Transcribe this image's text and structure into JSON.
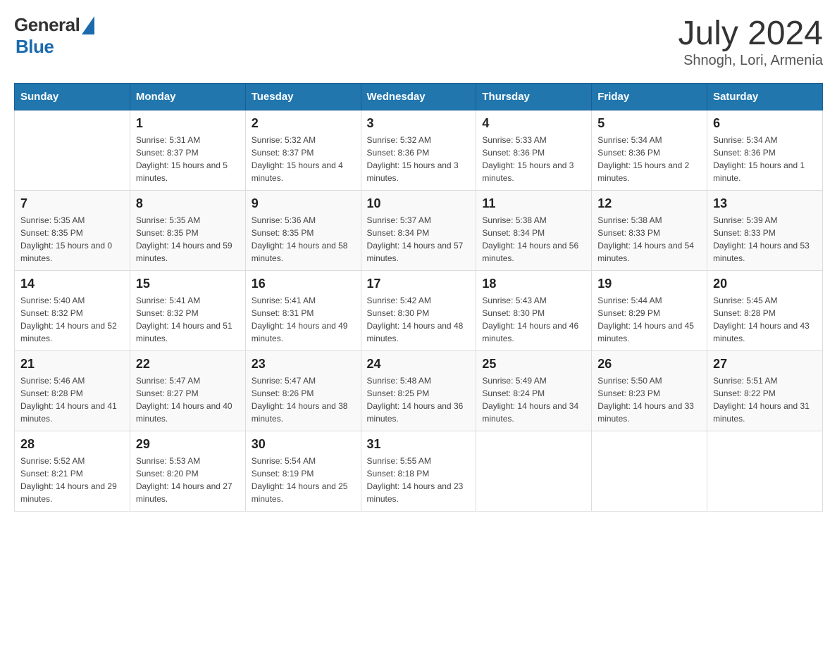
{
  "header": {
    "logo": {
      "general": "General",
      "blue": "Blue"
    },
    "month": "July 2024",
    "location": "Shnogh, Lori, Armenia"
  },
  "days_of_week": [
    "Sunday",
    "Monday",
    "Tuesday",
    "Wednesday",
    "Thursday",
    "Friday",
    "Saturday"
  ],
  "weeks": [
    [
      {
        "day": "",
        "sunrise": "",
        "sunset": "",
        "daylight": ""
      },
      {
        "day": "1",
        "sunrise": "Sunrise: 5:31 AM",
        "sunset": "Sunset: 8:37 PM",
        "daylight": "Daylight: 15 hours and 5 minutes."
      },
      {
        "day": "2",
        "sunrise": "Sunrise: 5:32 AM",
        "sunset": "Sunset: 8:37 PM",
        "daylight": "Daylight: 15 hours and 4 minutes."
      },
      {
        "day": "3",
        "sunrise": "Sunrise: 5:32 AM",
        "sunset": "Sunset: 8:36 PM",
        "daylight": "Daylight: 15 hours and 3 minutes."
      },
      {
        "day": "4",
        "sunrise": "Sunrise: 5:33 AM",
        "sunset": "Sunset: 8:36 PM",
        "daylight": "Daylight: 15 hours and 3 minutes."
      },
      {
        "day": "5",
        "sunrise": "Sunrise: 5:34 AM",
        "sunset": "Sunset: 8:36 PM",
        "daylight": "Daylight: 15 hours and 2 minutes."
      },
      {
        "day": "6",
        "sunrise": "Sunrise: 5:34 AM",
        "sunset": "Sunset: 8:36 PM",
        "daylight": "Daylight: 15 hours and 1 minute."
      }
    ],
    [
      {
        "day": "7",
        "sunrise": "Sunrise: 5:35 AM",
        "sunset": "Sunset: 8:35 PM",
        "daylight": "Daylight: 15 hours and 0 minutes."
      },
      {
        "day": "8",
        "sunrise": "Sunrise: 5:35 AM",
        "sunset": "Sunset: 8:35 PM",
        "daylight": "Daylight: 14 hours and 59 minutes."
      },
      {
        "day": "9",
        "sunrise": "Sunrise: 5:36 AM",
        "sunset": "Sunset: 8:35 PM",
        "daylight": "Daylight: 14 hours and 58 minutes."
      },
      {
        "day": "10",
        "sunrise": "Sunrise: 5:37 AM",
        "sunset": "Sunset: 8:34 PM",
        "daylight": "Daylight: 14 hours and 57 minutes."
      },
      {
        "day": "11",
        "sunrise": "Sunrise: 5:38 AM",
        "sunset": "Sunset: 8:34 PM",
        "daylight": "Daylight: 14 hours and 56 minutes."
      },
      {
        "day": "12",
        "sunrise": "Sunrise: 5:38 AM",
        "sunset": "Sunset: 8:33 PM",
        "daylight": "Daylight: 14 hours and 54 minutes."
      },
      {
        "day": "13",
        "sunrise": "Sunrise: 5:39 AM",
        "sunset": "Sunset: 8:33 PM",
        "daylight": "Daylight: 14 hours and 53 minutes."
      }
    ],
    [
      {
        "day": "14",
        "sunrise": "Sunrise: 5:40 AM",
        "sunset": "Sunset: 8:32 PM",
        "daylight": "Daylight: 14 hours and 52 minutes."
      },
      {
        "day": "15",
        "sunrise": "Sunrise: 5:41 AM",
        "sunset": "Sunset: 8:32 PM",
        "daylight": "Daylight: 14 hours and 51 minutes."
      },
      {
        "day": "16",
        "sunrise": "Sunrise: 5:41 AM",
        "sunset": "Sunset: 8:31 PM",
        "daylight": "Daylight: 14 hours and 49 minutes."
      },
      {
        "day": "17",
        "sunrise": "Sunrise: 5:42 AM",
        "sunset": "Sunset: 8:30 PM",
        "daylight": "Daylight: 14 hours and 48 minutes."
      },
      {
        "day": "18",
        "sunrise": "Sunrise: 5:43 AM",
        "sunset": "Sunset: 8:30 PM",
        "daylight": "Daylight: 14 hours and 46 minutes."
      },
      {
        "day": "19",
        "sunrise": "Sunrise: 5:44 AM",
        "sunset": "Sunset: 8:29 PM",
        "daylight": "Daylight: 14 hours and 45 minutes."
      },
      {
        "day": "20",
        "sunrise": "Sunrise: 5:45 AM",
        "sunset": "Sunset: 8:28 PM",
        "daylight": "Daylight: 14 hours and 43 minutes."
      }
    ],
    [
      {
        "day": "21",
        "sunrise": "Sunrise: 5:46 AM",
        "sunset": "Sunset: 8:28 PM",
        "daylight": "Daylight: 14 hours and 41 minutes."
      },
      {
        "day": "22",
        "sunrise": "Sunrise: 5:47 AM",
        "sunset": "Sunset: 8:27 PM",
        "daylight": "Daylight: 14 hours and 40 minutes."
      },
      {
        "day": "23",
        "sunrise": "Sunrise: 5:47 AM",
        "sunset": "Sunset: 8:26 PM",
        "daylight": "Daylight: 14 hours and 38 minutes."
      },
      {
        "day": "24",
        "sunrise": "Sunrise: 5:48 AM",
        "sunset": "Sunset: 8:25 PM",
        "daylight": "Daylight: 14 hours and 36 minutes."
      },
      {
        "day": "25",
        "sunrise": "Sunrise: 5:49 AM",
        "sunset": "Sunset: 8:24 PM",
        "daylight": "Daylight: 14 hours and 34 minutes."
      },
      {
        "day": "26",
        "sunrise": "Sunrise: 5:50 AM",
        "sunset": "Sunset: 8:23 PM",
        "daylight": "Daylight: 14 hours and 33 minutes."
      },
      {
        "day": "27",
        "sunrise": "Sunrise: 5:51 AM",
        "sunset": "Sunset: 8:22 PM",
        "daylight": "Daylight: 14 hours and 31 minutes."
      }
    ],
    [
      {
        "day": "28",
        "sunrise": "Sunrise: 5:52 AM",
        "sunset": "Sunset: 8:21 PM",
        "daylight": "Daylight: 14 hours and 29 minutes."
      },
      {
        "day": "29",
        "sunrise": "Sunrise: 5:53 AM",
        "sunset": "Sunset: 8:20 PM",
        "daylight": "Daylight: 14 hours and 27 minutes."
      },
      {
        "day": "30",
        "sunrise": "Sunrise: 5:54 AM",
        "sunset": "Sunset: 8:19 PM",
        "daylight": "Daylight: 14 hours and 25 minutes."
      },
      {
        "day": "31",
        "sunrise": "Sunrise: 5:55 AM",
        "sunset": "Sunset: 8:18 PM",
        "daylight": "Daylight: 14 hours and 23 minutes."
      },
      {
        "day": "",
        "sunrise": "",
        "sunset": "",
        "daylight": ""
      },
      {
        "day": "",
        "sunrise": "",
        "sunset": "",
        "daylight": ""
      },
      {
        "day": "",
        "sunrise": "",
        "sunset": "",
        "daylight": ""
      }
    ]
  ]
}
